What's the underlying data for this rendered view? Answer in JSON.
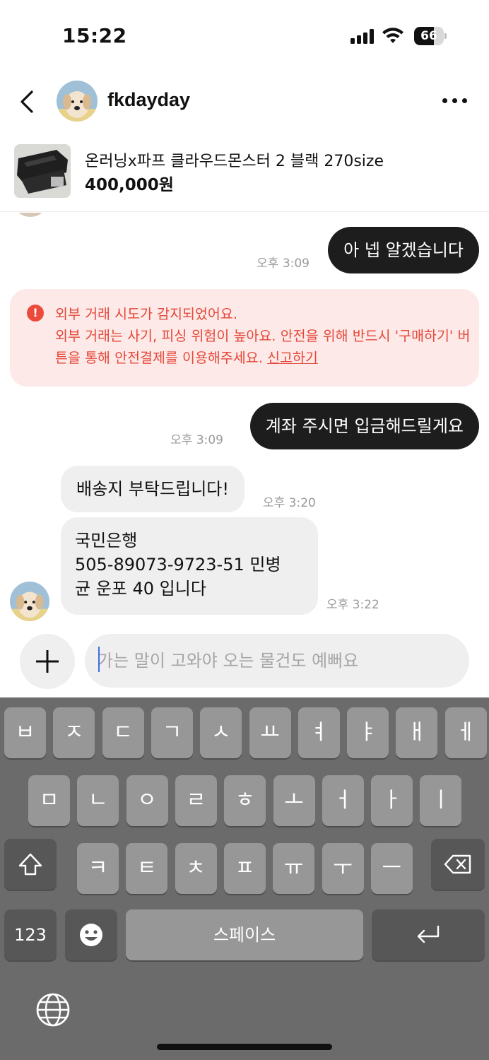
{
  "status": {
    "time": "15:22",
    "battery": "66",
    "battery_level": 0.66
  },
  "header": {
    "username": "fkdayday",
    "back_icon": "chevron-left-icon",
    "more_icon": "more-dots-icon"
  },
  "product": {
    "title": "온러닝x파프 클라우드몬스터 2 블랙 270size",
    "price": "400,000원"
  },
  "messages": [
    {
      "from": "me",
      "text": "아 넵 알겠습니다",
      "time": "오후 3:09"
    },
    {
      "from": "me",
      "text": "계좌 주시면 입금해드릴게요",
      "time": "오후 3:09"
    },
    {
      "from": "them",
      "text": "배송지 부탁드립니다!",
      "time": "오후 3:20"
    },
    {
      "from": "them",
      "text": "국민은행\n505-89073-9723-51 민병\n균 운포 40 입니다",
      "time": "오후 3:22"
    }
  ],
  "alert": {
    "icon": "!",
    "line1": "외부 거래 시도가 감지되었어요.",
    "line2": "외부 거래는 사기, 피싱 위험이 높아요. 안전을 위해 반드시 '구매하기' 버튼을 통해 안전결제를 이용해주세요.",
    "link": "신고하기",
    "color": "#e4483a",
    "bg": "#fde9e7"
  },
  "input": {
    "placeholder": "가는 말이 고와야 오는 물건도 예뻐요"
  },
  "keyboard": {
    "row1": [
      "ㅂ",
      "ㅈ",
      "ㄷ",
      "ㄱ",
      "ㅅ",
      "ㅛ",
      "ㅕ",
      "ㅑ",
      "ㅐ",
      "ㅔ"
    ],
    "row2": [
      "ㅁ",
      "ㄴ",
      "ㅇ",
      "ㄹ",
      "ㅎ",
      "ㅗ",
      "ㅓ",
      "ㅏ",
      "ㅣ"
    ],
    "row3": [
      "ㅋ",
      "ㅌ",
      "ㅊ",
      "ㅍ",
      "ㅠ",
      "ㅜ",
      "ㅡ"
    ],
    "numbers": "123",
    "space": "스페이스",
    "shift_icon": "shift-icon",
    "backspace_icon": "backspace-icon",
    "emoji_icon": "emoji-icon",
    "return_icon": "return-icon",
    "globe_icon": "globe-icon"
  }
}
